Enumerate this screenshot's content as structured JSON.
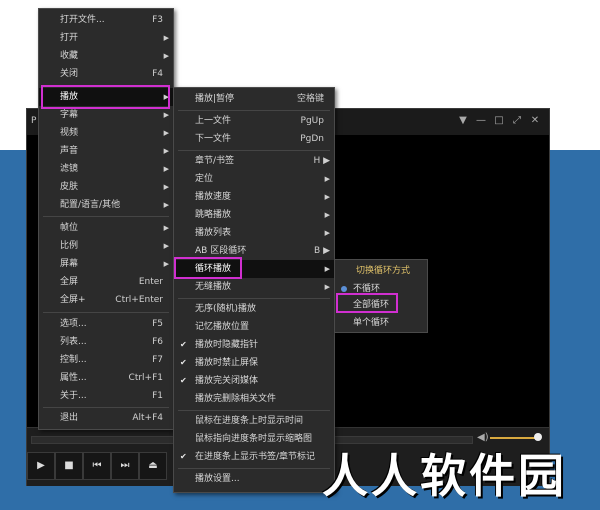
{
  "player": {
    "title": "P",
    "window_buttons": [
      "▼",
      "—",
      "□",
      "⤢",
      "✕"
    ],
    "controls": [
      "▶",
      "■",
      "⏮",
      "⏭",
      "⏏"
    ],
    "volume_icon": "◀)"
  },
  "main_menu": [
    {
      "label": "打开文件...",
      "shortcut": "F3"
    },
    {
      "label": "打开",
      "arrow": "▶"
    },
    {
      "label": "收藏",
      "arrow": "▶"
    },
    {
      "label": "关闭",
      "shortcut": "F4"
    },
    {
      "label": "播放",
      "arrow": "▶"
    },
    {
      "label": "字幕",
      "arrow": "▶"
    },
    {
      "label": "视频",
      "arrow": "▶"
    },
    {
      "label": "声音",
      "arrow": "▶"
    },
    {
      "label": "滤镜",
      "arrow": "▶"
    },
    {
      "label": "皮肤",
      "arrow": "▶"
    },
    {
      "label": "配置/语言/其他",
      "arrow": "▶"
    },
    {
      "label": "帧位",
      "arrow": "▶"
    },
    {
      "label": "比例",
      "arrow": "▶"
    },
    {
      "label": "屏幕",
      "arrow": "▶"
    },
    {
      "label": "全屏",
      "shortcut": "Enter"
    },
    {
      "label": "全屏+",
      "shortcut": "Ctrl+Enter"
    },
    {
      "label": "选项...",
      "shortcut": "F5"
    },
    {
      "label": "列表...",
      "shortcut": "F6"
    },
    {
      "label": "控制...",
      "shortcut": "F7"
    },
    {
      "label": "属性...",
      "shortcut": "Ctrl+F1"
    },
    {
      "label": "关于...",
      "shortcut": "F1"
    },
    {
      "label": "退出",
      "shortcut": "Alt+F4"
    }
  ],
  "play_menu": [
    {
      "label": "播放|暂停",
      "shortcut": "空格键"
    },
    {
      "label": "上一文件",
      "shortcut": "PgUp"
    },
    {
      "label": "下一文件",
      "shortcut": "PgDn"
    },
    {
      "label": "章节/书签",
      "shortcut": "H ▶"
    },
    {
      "label": "定位",
      "arrow": "▶"
    },
    {
      "label": "播放速度",
      "arrow": "▶"
    },
    {
      "label": "跳略播放",
      "arrow": "▶"
    },
    {
      "label": "播放列表",
      "arrow": "▶"
    },
    {
      "label": "AB 区段循环",
      "shortcut": "B ▶"
    },
    {
      "label": "循环播放",
      "arrow": "▶"
    },
    {
      "label": "无缝播放",
      "arrow": "▶"
    },
    {
      "label": "无序(随机)播放"
    },
    {
      "label": "记忆播放位置"
    },
    {
      "label": "播放时隐藏指针",
      "check": "✔"
    },
    {
      "label": "播放时禁止屏保",
      "check": "✔"
    },
    {
      "label": "播放完关闭媒体",
      "check": "✔"
    },
    {
      "label": "播放完删除相关文件"
    },
    {
      "label": "鼠标在进度条上时显示时间"
    },
    {
      "label": "鼠标指向进度条时显示缩略图"
    },
    {
      "label": "在进度条上显示书签/章节标记",
      "check": "✔"
    },
    {
      "label": "播放设置..."
    }
  ],
  "loop_menu": {
    "header": "切换循环方式",
    "items": [
      "不循环",
      "全部循环",
      "单个循环"
    ]
  },
  "watermark": "人人软件园"
}
